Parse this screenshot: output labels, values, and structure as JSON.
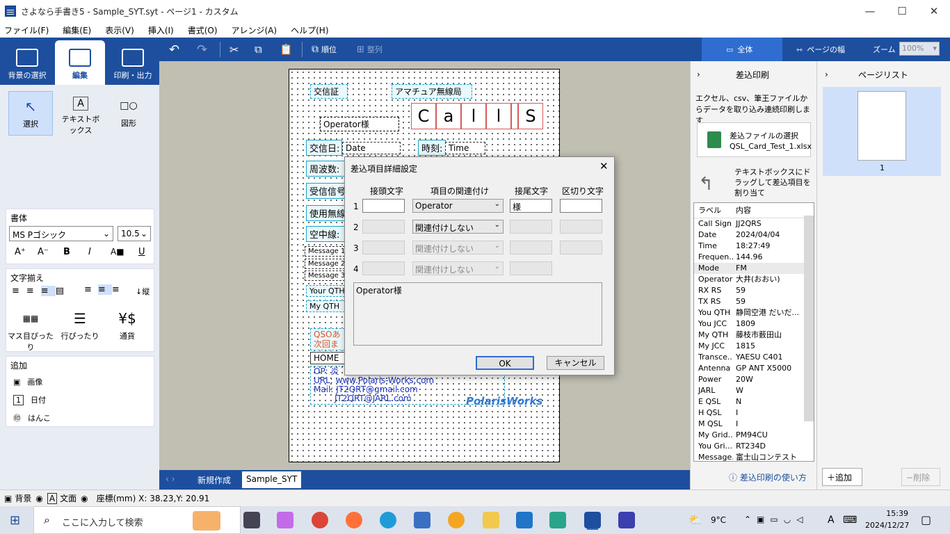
{
  "window": {
    "title": "さよなら手書き5 - Sample_SYT.syt - ページ1 - カスタム",
    "min": "—",
    "max": "☐",
    "close": "✕"
  },
  "menu": [
    "ファイル(F)",
    "編集(E)",
    "表示(V)",
    "挿入(I)",
    "書式(O)",
    "アレンジ(A)",
    "ヘルプ(H)"
  ],
  "ribbon_tabs": [
    {
      "label": "背景の選択"
    },
    {
      "label": "編集"
    },
    {
      "label": "印刷・出力"
    }
  ],
  "toolbar": {
    "order": "順位",
    "align": "整列",
    "view_all": "全体",
    "page_width": "ページの幅",
    "zoom_label": "ズーム",
    "zoom_value": "100%"
  },
  "tools": [
    {
      "label": "選択"
    },
    {
      "label": "テキストボックス"
    },
    {
      "label": "図形"
    }
  ],
  "font_section": {
    "title": "書体",
    "font": "MS Pゴシック",
    "size": "10.5"
  },
  "align_section": {
    "title": "文字揃え",
    "vertical": "縦"
  },
  "layout_tools": [
    {
      "label": "マス目ぴったり"
    },
    {
      "label": "行ぴったり"
    },
    {
      "label": "通貨"
    }
  ],
  "add_section": {
    "title": "追加",
    "items": [
      "画像",
      "日付",
      "はんこ"
    ]
  },
  "page_fields": {
    "kotsu": "交信証",
    "amateur": "アマチュア無線局",
    "operator": "Operator様",
    "call": [
      "C",
      "a",
      "l",
      "l",
      "",
      "S"
    ],
    "date_label": "交信日:",
    "date_val": "Date",
    "time_label": "時刻:",
    "time_val": "Time",
    "freq_label": "周波数:",
    "rx_label": "受信信号",
    "rig_label": "使用無線",
    "ant_label": "空中線:",
    "msg1": "Message 1",
    "msg2": "Message 2",
    "msg3": "Message 3",
    "your_qth": "Your QTH",
    "my_qth": "My QTH",
    "qso1": "QSOあ",
    "qso2": "次回ま",
    "home": "HOME",
    "op": "OP: 炎",
    "url": "URL: www.Polaris-Works.com",
    "mail": "Mail: JT2QRT@gmail.com",
    "mail2": "JT2QRT@JARL.com",
    "logo": "PolarisWorks"
  },
  "bottom_tabs": {
    "new": "新規作成",
    "current": "Sample_SYT"
  },
  "status": {
    "bg": "背景",
    "text": "文面",
    "coords": "座標(mm) X:  38.23,Y:  20.91"
  },
  "merge_panel": {
    "title": "差込印刷",
    "desc": "エクセル、csv、筆王ファイルからデータを取り込み連続印刷します",
    "file_btn": "差込ファイルの選択",
    "file_name": "QSL_Card_Test_1.xlsx",
    "drag_hint": "テキストボックスにドラッグして差込項目を割り当て",
    "col_label": "ラベル",
    "col_value": "内容",
    "help": "差込印刷の使い方",
    "rows": [
      [
        "Call Sign",
        "JJ2QRS"
      ],
      [
        "Date",
        "2024/04/04"
      ],
      [
        "Time",
        "18:27:49"
      ],
      [
        "Frequen...",
        "144.96"
      ],
      [
        "Mode",
        "FM"
      ],
      [
        "Operator",
        "大井(おおい)"
      ],
      [
        "RX RS",
        "59"
      ],
      [
        "TX RS",
        "59"
      ],
      [
        "You QTH",
        "静岡空港 だいだ..."
      ],
      [
        "You JCC",
        "1809"
      ],
      [
        "My QTH",
        "藤枝市薮田山"
      ],
      [
        "My JCC",
        "1815"
      ],
      [
        "Transce...",
        "YAESU C401"
      ],
      [
        "Antenna",
        "GP ANT X5000"
      ],
      [
        "Power",
        "20W"
      ],
      [
        "JARL",
        "W"
      ],
      [
        "E QSL",
        "N"
      ],
      [
        "H QSL",
        "I"
      ],
      [
        "M QSL",
        "I"
      ],
      [
        "My Grid...",
        "PM94CU"
      ],
      [
        "You Gri...",
        "RT234D"
      ],
      [
        "Message...",
        "富士山コンテスト"
      ]
    ]
  },
  "page_list": {
    "title": "ページリスト",
    "page_num": "1",
    "add": "追加",
    "delete": "削除"
  },
  "dialog": {
    "title": "差込項目詳細設定",
    "col_prefix": "接頭文字",
    "col_link": "項目の関連付け",
    "col_suffix": "接尾文字",
    "col_sep": "区切り文字",
    "rows": [
      {
        "n": "1",
        "prefix": "",
        "link": "Operator",
        "suffix": "様",
        "sep": ""
      },
      {
        "n": "2",
        "prefix": "",
        "link": "関連付けしない",
        "suffix": "",
        "sep": ""
      },
      {
        "n": "3",
        "prefix": "",
        "link": "関連付けしない",
        "suffix": "",
        "sep": ""
      },
      {
        "n": "4",
        "prefix": "",
        "link": "関連付けしない",
        "suffix": ""
      }
    ],
    "preview": "Operator様",
    "ok": "OK",
    "cancel": "キャンセル"
  },
  "taskbar": {
    "search": "ここに入力して検索",
    "temp": "9°C",
    "ime": "A",
    "time": "15:39",
    "date": "2024/12/27"
  }
}
